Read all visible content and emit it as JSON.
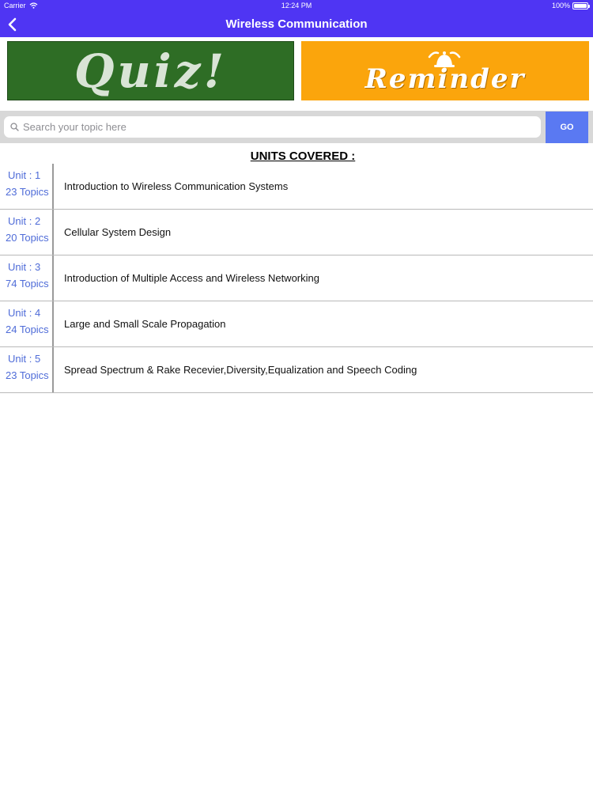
{
  "status_bar": {
    "carrier": "Carrier",
    "time": "12:24 PM",
    "battery": "100%"
  },
  "nav": {
    "title": "Wireless Communication"
  },
  "banners": {
    "quiz": "Quiz!",
    "reminder": "Reminder"
  },
  "search": {
    "placeholder": "Search your topic here",
    "go_label": "GO"
  },
  "units_heading": "UNITS COVERED :",
  "units": [
    {
      "unit": "Unit : 1",
      "topics": "23 Topics",
      "name": "Introduction to Wireless Communication Systems"
    },
    {
      "unit": "Unit : 2",
      "topics": "20 Topics",
      "name": "Cellular System Design"
    },
    {
      "unit": "Unit : 3",
      "topics": "74 Topics",
      "name": "Introduction of Multiple Access and Wireless Networking"
    },
    {
      "unit": "Unit : 4",
      "topics": "24 Topics",
      "name": "Large and Small Scale Propagation"
    },
    {
      "unit": "Unit : 5",
      "topics": "23 Topics",
      "name": "Spread Spectrum & Rake Recevier,Diversity,Equalization and Speech Coding"
    }
  ],
  "colors": {
    "nav_bg": "#4f35f3",
    "go_bg": "#5a79f2",
    "unit_link": "#4f6cd8",
    "quiz_bg": "#2e6d25",
    "reminder_bg": "#fba50c"
  },
  "icons": {
    "back": "chevron-left-icon",
    "search": "magnifier-icon",
    "wifi": "wifi-icon",
    "battery": "battery-icon",
    "bell": "bell-icon"
  }
}
